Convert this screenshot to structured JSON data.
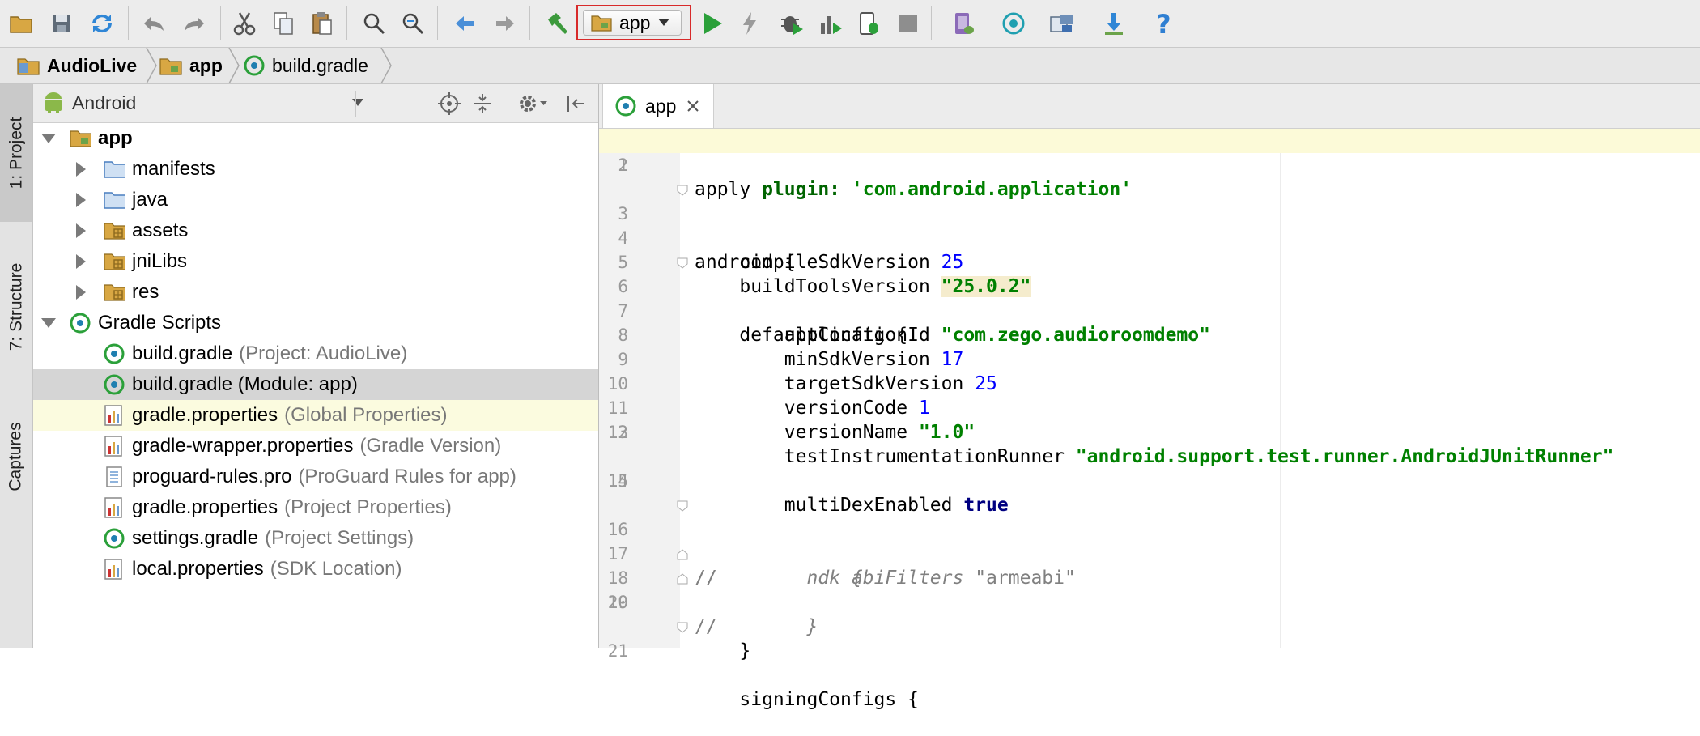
{
  "toolbar": {
    "run_config_label": "app"
  },
  "breadcrumb": [
    "AudioLive",
    "app",
    "build.gradle"
  ],
  "tool_strip": {
    "project_tab": "1: Project",
    "structure_tab": "7: Structure",
    "captures_tab": "Captures"
  },
  "project_panel": {
    "view_mode": "Android",
    "rows": [
      {
        "name": "app",
        "hint": ""
      },
      {
        "name": "manifests",
        "hint": ""
      },
      {
        "name": "java",
        "hint": ""
      },
      {
        "name": "assets",
        "hint": ""
      },
      {
        "name": "jniLibs",
        "hint": ""
      },
      {
        "name": "res",
        "hint": ""
      },
      {
        "name": "Gradle Scripts",
        "hint": ""
      },
      {
        "name": "build.gradle",
        "hint": "(Project: AudioLive)"
      },
      {
        "name": "build.gradle",
        "hint": "(Module: app)"
      },
      {
        "name": "gradle.properties",
        "hint": "(Global Properties)"
      },
      {
        "name": "gradle-wrapper.properties",
        "hint": "(Gradle Version)"
      },
      {
        "name": "proguard-rules.pro",
        "hint": "(ProGuard Rules for app)"
      },
      {
        "name": "gradle.properties",
        "hint": "(Project Properties)"
      },
      {
        "name": "settings.gradle",
        "hint": "(Project Settings)"
      },
      {
        "name": "local.properties",
        "hint": "(SDK Location)"
      }
    ]
  },
  "editor": {
    "tab_label": "app",
    "line_numbers": [
      "1",
      "2",
      "3",
      "4",
      "5",
      "6",
      "7",
      "8",
      "9",
      "10",
      "11",
      "12",
      "13",
      "14",
      "15",
      "16",
      "17",
      "18",
      "19",
      "20",
      "21"
    ],
    "lines": {
      "l1a": "apply ",
      "l1b": "plugin: ",
      "l1c": "'com.android.application'",
      "l3": "android {",
      "l4a": "    compileSdkVersion ",
      "l4b": "25",
      "l5a": "    buildToolsVersion ",
      "l5b": "\"25.0.2\"",
      "l6": "    defaultConfig {",
      "l7a": "        applicationId ",
      "l7b": "\"com.zego.audioroomdemo\"",
      "l8a": "        minSdkVersion ",
      "l8b": "17",
      "l9a": "        targetSdkVersion ",
      "l9b": "25",
      "l10a": "        versionCode ",
      "l10b": "1",
      "l11a": "        versionName ",
      "l11b": "\"1.0\"",
      "l12a": "        testInstrumentationRunner ",
      "l12b": "\"android.support.test.runner.AndroidJUnitRunner\"",
      "l14a": "        multiDexEnabled ",
      "l14b": "true",
      "l16a": "//",
      "l16b": "        ndk {",
      "l17a": "//",
      "l17b": "            abiFilters ",
      "l17c": "\"armeabi\"",
      "l18a": "//",
      "l18b": "        }",
      "l19": "    }",
      "l21": "    signingConfigs {"
    }
  }
}
